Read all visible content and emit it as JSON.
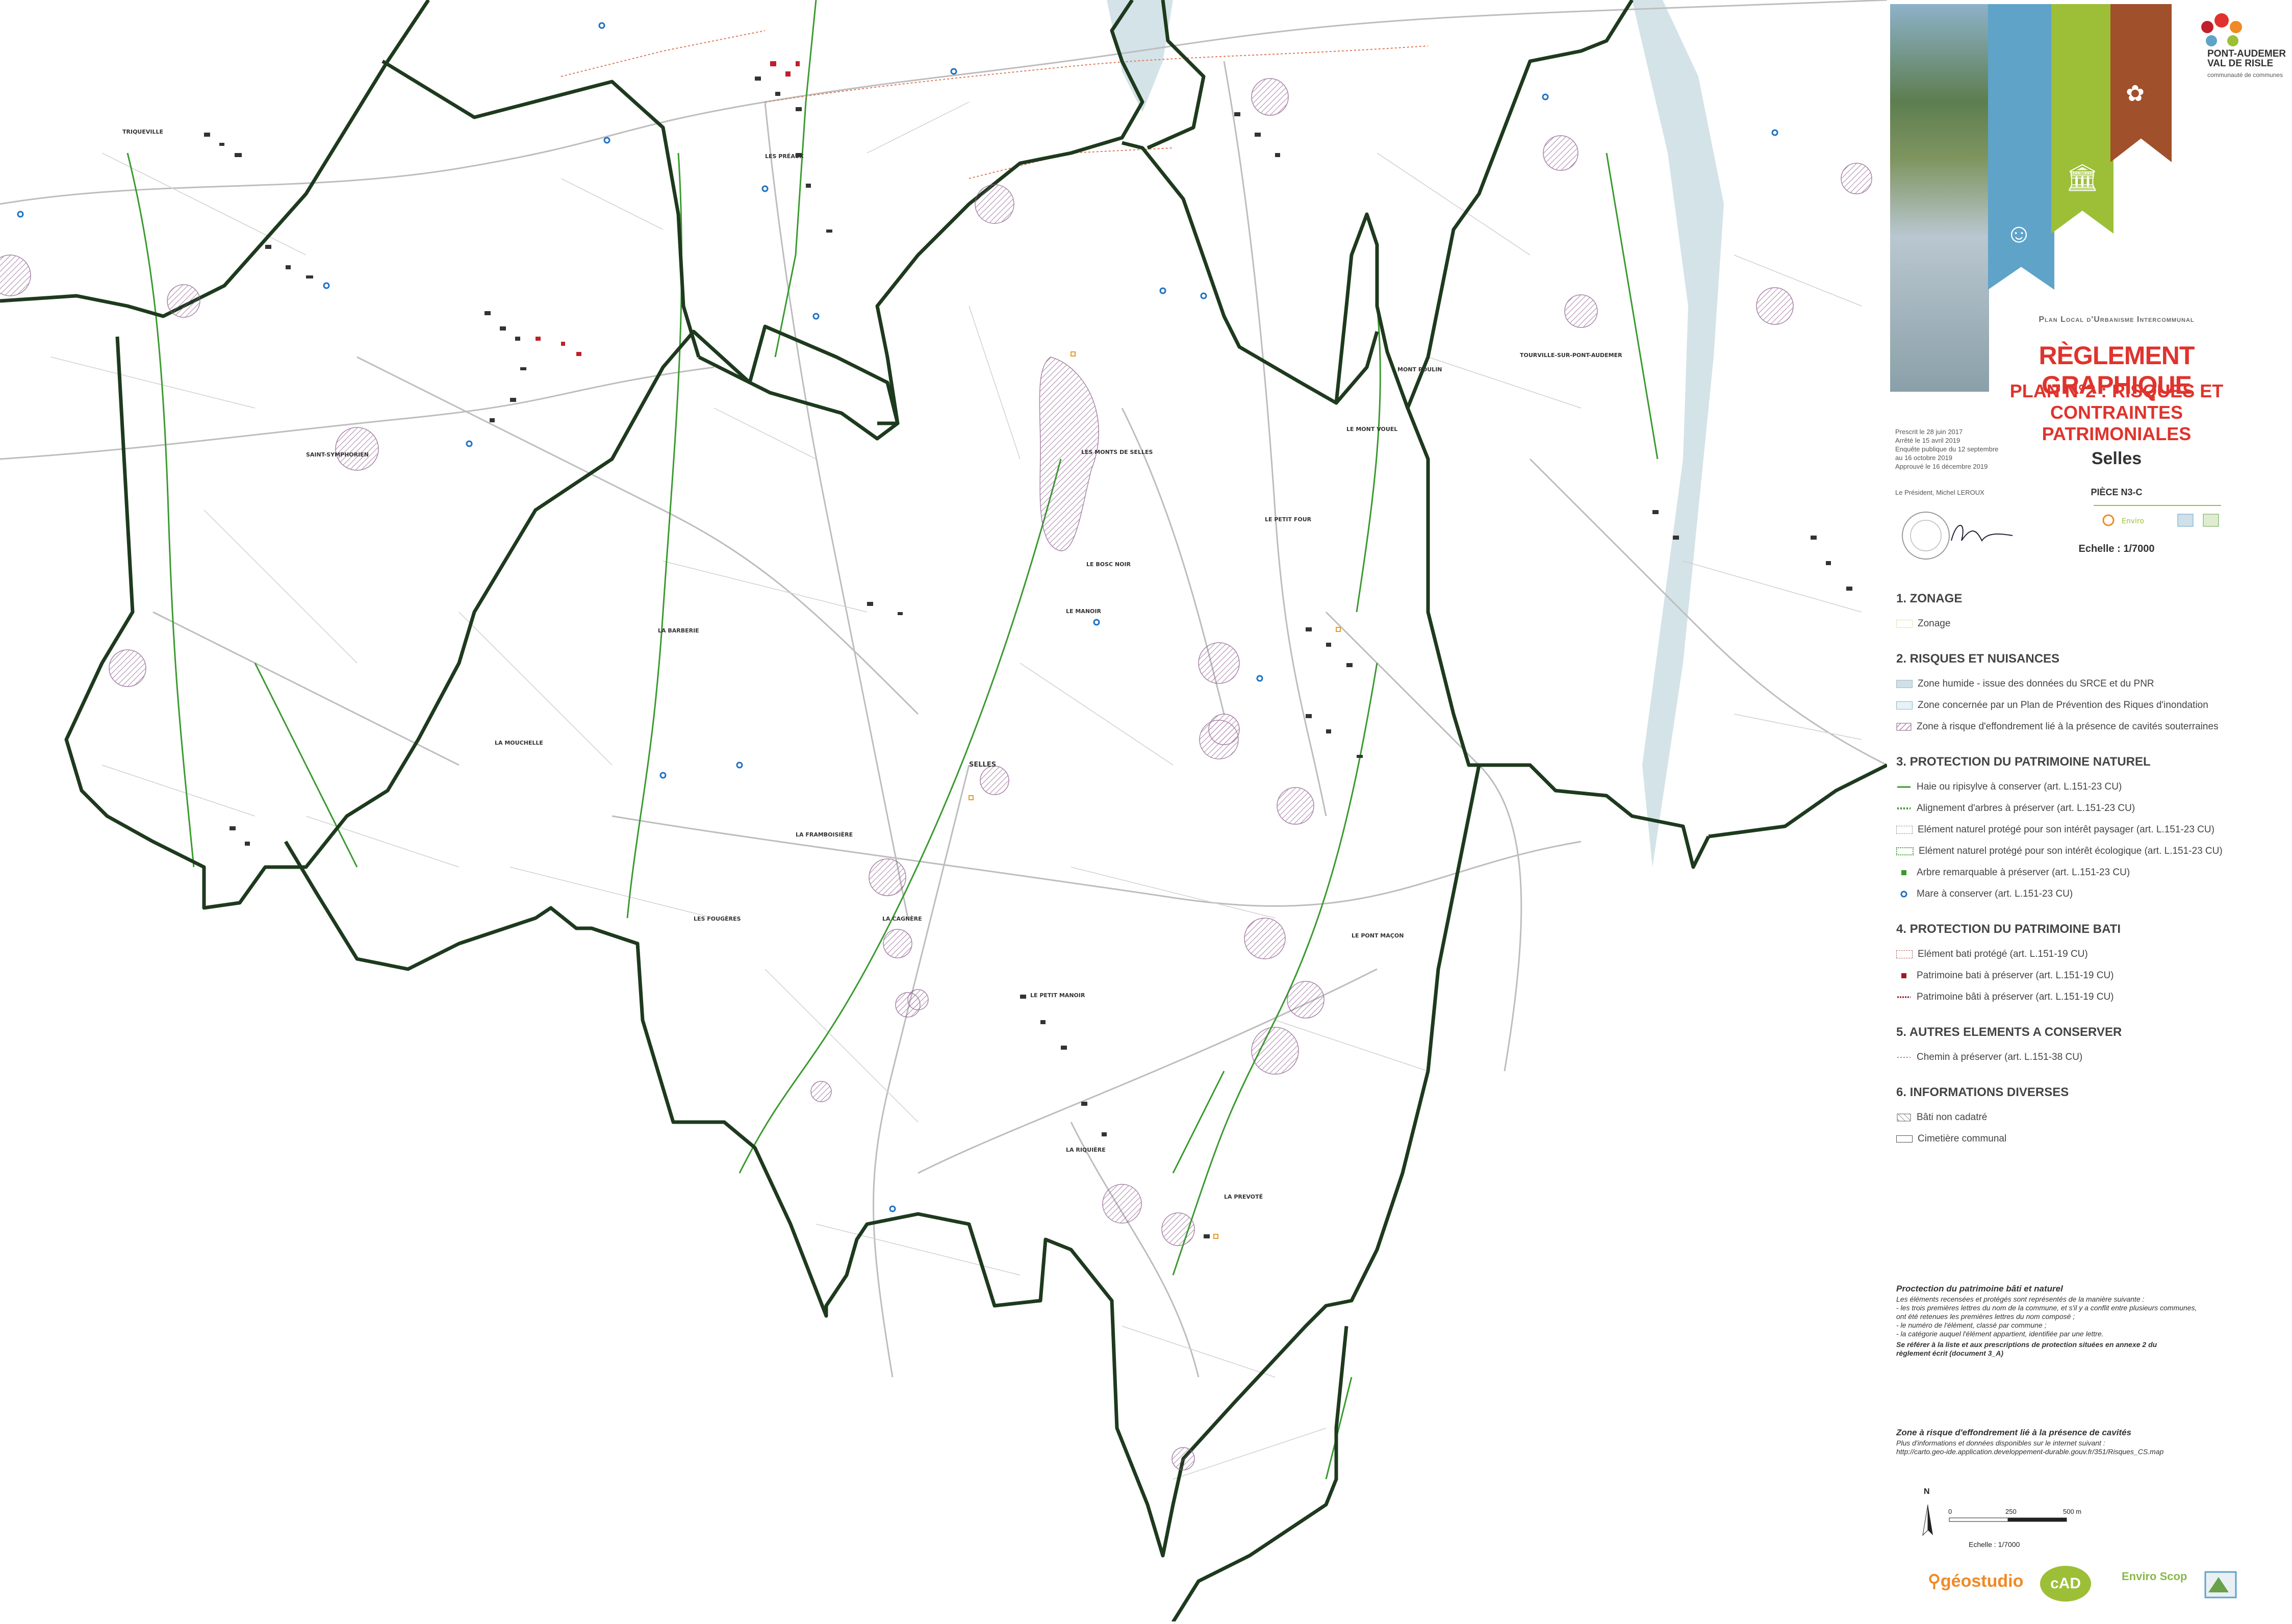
{
  "map": {
    "places": [
      {
        "name": "TRIQUEVILLE"
      },
      {
        "name": "LES PRÉAUX"
      },
      {
        "name": "SAINT-SYMPHORIEN"
      },
      {
        "name": "TOURVILLE-SUR-PONT-AUDEMER"
      },
      {
        "name": "SELLES"
      },
      {
        "name": "LA BARBERIE"
      },
      {
        "name": "LA MOUCHELLE"
      },
      {
        "name": "LE PETIT FOUR"
      },
      {
        "name": "LE BOSC NOIR"
      },
      {
        "name": "LE MANOIR"
      },
      {
        "name": "LA FRAMBOISIÈRE"
      },
      {
        "name": "LA CAGNÈRE"
      },
      {
        "name": "LES FOUGÈRES"
      },
      {
        "name": "LE PETIT MANOIR"
      },
      {
        "name": "LA RIQUIÈRE"
      },
      {
        "name": "LA PREVOTÉ"
      },
      {
        "name": "LE PONT MAÇON"
      },
      {
        "name": "MONT POULIN"
      },
      {
        "name": "LE MONT VOUEL"
      },
      {
        "name": "LES MONTS DE SELLES"
      }
    ]
  },
  "title_block": {
    "logo_text": "PONT-AUDEMER VAL DE RISLE",
    "logo_sub": "communauté de communes",
    "plan_label": "Plan Local d'Urbanisme Intercommunal",
    "reglement": "RÈGLEMENT GRAPHIQUE",
    "plan2_line1": "PLAN N°2 : RISQUES ET",
    "plan2_line2": "CONTRAINTES PATRIMONIALES",
    "commune": "Selles",
    "piece": "PIÈCE N3-C",
    "echelle": "Echelle : 1/7000",
    "dates": [
      "Prescrit le 28 juin 2017",
      "Arrêté le 15 avril 2019",
      "Enquête publique du 12 septembre",
      "au 16 octobre 2019",
      "Approuvé le 16 décembre 2019"
    ],
    "president": "Le Président, Michel LEROUX"
  },
  "legend": {
    "s1": {
      "title": "1. ZONAGE",
      "items": [
        "Zonage"
      ]
    },
    "s2": {
      "title": "2. RISQUES ET NUISANCES",
      "items": [
        "Zone humide - issue des données du SRCE et du PNR",
        "Zone concernée par un Plan de Prévention des Riques d'inondation",
        "Zone à risque d'effondrement lié à la présence de cavités souterraines"
      ]
    },
    "s3": {
      "title": "3. PROTECTION DU PATRIMOINE NATUREL",
      "items": [
        "Haie ou ripisylve à conserver (art. L.151-23 CU)",
        "Alignement d'arbres à préserver (art. L.151-23 CU)",
        "Elément naturel protégé pour son intérêt paysager (art. L.151-23 CU)",
        "Elément naturel protégé pour son intérêt écologique (art. L.151-23 CU)",
        "Arbre remarquable à préserver (art. L.151-23 CU)",
        "Mare à conserver (art. L.151-23 CU)"
      ]
    },
    "s4": {
      "title": "4. PROTECTION DU PATRIMOINE BATI",
      "items": [
        "Elément bati protégé (art. L.151-19 CU)",
        "Patrimoine bati à préserver (art. L.151-19 CU)",
        "Patrimoine bâti à préserver (art. L.151-19 CU)"
      ]
    },
    "s5": {
      "title": "5. AUTRES ELEMENTS A CONSERVER",
      "items": [
        "Chemin à préserver  (art. L.151-38 CU)"
      ]
    },
    "s6": {
      "title": "6. INFORMATIONS DIVERSES",
      "items": [
        "Bâti non cadatré",
        "Cimetière communal"
      ]
    }
  },
  "notes": {
    "n1_title": "Proctection du patrimoine bâti et naturel",
    "n1_lines": [
      "Les éléments recensées et protégés sont représentés de la manière suivante :",
      "- les trois premières lettres du nom de la commune, et s'il y a conflit entre plusieurs communes,",
      "ont été retenues les premières lettres du nom composé ;",
      "- le numéro de l'élément, classé par commune ;",
      "- la catégorie auquel l'élément appartient, identifiée par une lettre."
    ],
    "n1_ref": "Se référer à la liste et aux prescriptions de protection situées en annexe 2 du règlement écrit (document 3_A)",
    "n2_title": "Zone à risque d'effondrement lié à la présence de cavités",
    "n2_lines": [
      "Plus d'informations et données disponibles sur le internet suivant :",
      "http://carto.geo-ide.application.developpement-durable.gouv.fr/351/Risques_CS.map"
    ]
  },
  "scale": {
    "north": "N",
    "t0": "0",
    "t1": "250",
    "t2": "500  m",
    "label": "Echelle : 1/7000"
  },
  "partners": {
    "geostudio": "géostudio",
    "cad": "cAD",
    "enviro": "Enviro Scop"
  },
  "colors": {
    "hedge": "#3a9a2f",
    "boundary": "#1e3a1e",
    "road": "#b8b8b8",
    "red": "#e0332d",
    "cavity": "#8a5a8a",
    "mare": "#1d72c4"
  }
}
